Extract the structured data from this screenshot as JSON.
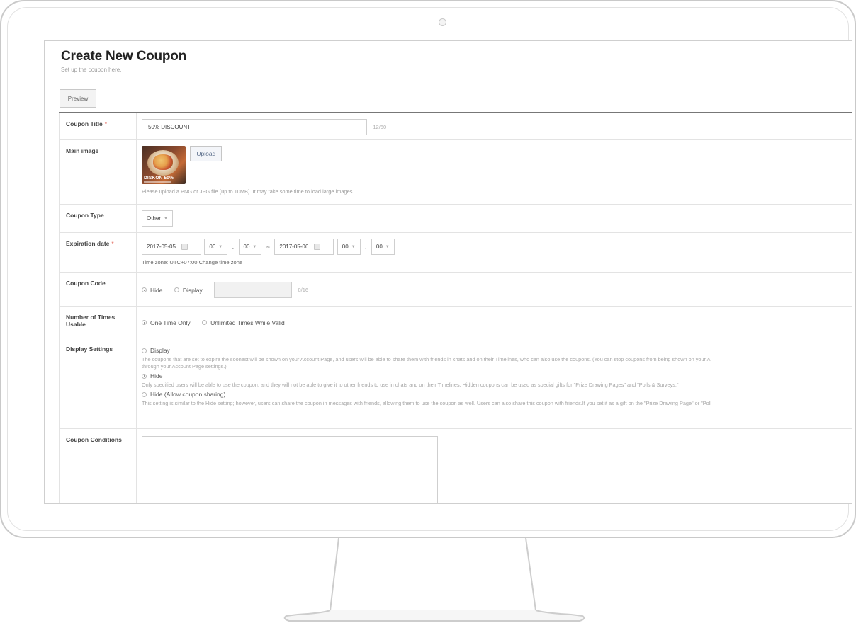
{
  "page": {
    "title": "Create New Coupon",
    "subtitle": "Set up the coupon here.",
    "preview_label": "Preview"
  },
  "fields": {
    "title": {
      "label": "Coupon Title",
      "required": "*",
      "value": "50% DISCOUNT",
      "counter": "12/60"
    },
    "image": {
      "label": "Main image",
      "upload_label": "Upload",
      "thumb_text": "DISKON 50%",
      "help": "Please upload a PNG or JPG file (up to 10MB). It may take some time to load large images."
    },
    "type": {
      "label": "Coupon Type",
      "value": "Other"
    },
    "expiration": {
      "label": "Expiration date",
      "required": "*",
      "start_date": "2017-05-05",
      "start_hour": "00",
      "start_min": "00",
      "range_sep": "~",
      "end_date": "2017-05-06",
      "end_hour": "00",
      "end_min": "00",
      "time_sep": ":",
      "timezone_label": "Time zone: UTC+07:00",
      "timezone_link": "Change time zone"
    },
    "code": {
      "label": "Coupon Code",
      "opt_hide": "Hide",
      "opt_display": "Display",
      "counter": "0/16"
    },
    "usage": {
      "label": "Number of Times Usable",
      "opt_once": "One Time Only",
      "opt_unlimited": "Unlimited Times While Valid"
    },
    "display": {
      "label": "Display Settings",
      "opt_display": "Display",
      "desc_display": "The coupons that are set to expire the soonest will be shown on your Account Page, and users will be able to share them with friends in chats and on their Timelines, who can also use the coupons. (You can stop coupons from being shown on your A",
      "desc_display_2": "through your Account Page settings.)",
      "opt_hide": "Hide",
      "desc_hide": "Only specified users will be able to use the coupon, and they will not be able to give it to other friends to use in chats and on their Timelines. Hidden coupons can be used as special gifts for \"Prize Drawing Pages\" and \"Polls & Surveys.\"",
      "opt_hide_share": "Hide (Allow coupon sharing)",
      "desc_hide_share": "This setting is similar to the Hide setting; however, users can share the coupon in messages with friends, allowing them to use the coupon as well. Users can also share this coupon with friends.If you set it as a gift on the \"Prize Drawing Page\" or \"Poll"
    },
    "conditions": {
      "label": "Coupon Conditions"
    }
  }
}
